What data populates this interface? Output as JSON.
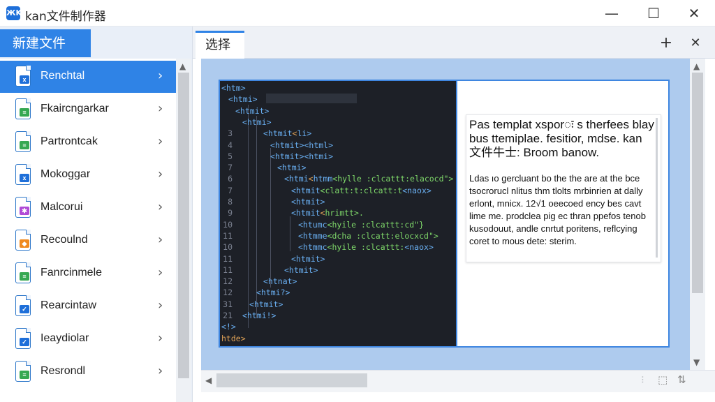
{
  "window": {
    "title": "kan文件制作器",
    "app_icon_text": "ЖK",
    "minimize_glyph": "—",
    "maximize_glyph": "☐",
    "close_glyph": "✕"
  },
  "sidebar": {
    "new_file_label": "新建文件",
    "items": [
      {
        "label": "Renchtal",
        "selected": true,
        "icon": "file-icon",
        "badge_color": "#1e6fd9",
        "badge_glyph": "x"
      },
      {
        "label": "Fkaircngarkar",
        "selected": false,
        "icon": "file-icon",
        "badge_color": "#36a852",
        "badge_glyph": "≡"
      },
      {
        "label": "Partrontcak",
        "selected": false,
        "icon": "file-icon",
        "badge_color": "#36a852",
        "badge_glyph": "≡"
      },
      {
        "label": "Mokoggar",
        "selected": false,
        "icon": "file-icon",
        "badge_color": "#1e6fd9",
        "badge_glyph": "x"
      },
      {
        "label": "Malcorui",
        "selected": false,
        "icon": "file-icon",
        "badge_color": "#b04bd6",
        "badge_glyph": "✱"
      },
      {
        "label": "Recoulnd",
        "selected": false,
        "icon": "file-icon",
        "badge_color": "#f08a1e",
        "badge_glyph": "◆"
      },
      {
        "label": "Fanrcinmele",
        "selected": false,
        "icon": "file-icon",
        "badge_color": "#36a852",
        "badge_glyph": "≡"
      },
      {
        "label": "Rearcintaw",
        "selected": false,
        "icon": "file-icon",
        "badge_color": "#1e6fd9",
        "badge_glyph": "✓"
      },
      {
        "label": "Ieaydiolar",
        "selected": false,
        "icon": "file-icon",
        "badge_color": "#1e6fd9",
        "badge_glyph": "✓"
      },
      {
        "label": "Resrondl",
        "selected": false,
        "icon": "file-icon",
        "badge_color": "#36a852",
        "badge_glyph": "≡"
      }
    ]
  },
  "tabs": {
    "active_label": "选择",
    "add_glyph": "+",
    "close_glyph": "✕"
  },
  "editor": {
    "lines": [
      {
        "num": "",
        "html_tokens": [
          [
            "tag",
            "<htm>"
          ]
        ],
        "indent": 0
      },
      {
        "num": "",
        "html_tokens": [
          [
            "tag",
            "<htmi>"
          ]
        ],
        "indent": 1
      },
      {
        "num": "",
        "html_tokens": [
          [
            "tag",
            "<htmit>"
          ]
        ],
        "indent": 2
      },
      {
        "num": "",
        "html_tokens": [
          [
            "tag",
            "<htmi>"
          ]
        ],
        "indent": 3
      },
      {
        "num": "3",
        "html_tokens": [
          [
            "tag",
            "<htmit"
          ],
          [
            "attr",
            "<"
          ],
          [
            "tag",
            "li>"
          ]
        ],
        "indent": 4
      },
      {
        "num": "4",
        "html_tokens": [
          [
            "tag",
            "<htmit>"
          ],
          [
            "tag",
            "<html>"
          ]
        ],
        "indent": 5
      },
      {
        "num": "5",
        "html_tokens": [
          [
            "tag",
            "<htmit>"
          ],
          [
            "tag",
            "<htmi>"
          ]
        ],
        "indent": 5
      },
      {
        "num": "7",
        "html_tokens": [
          [
            "tag",
            "<htmi>"
          ]
        ],
        "indent": 6
      },
      {
        "num": "6",
        "html_tokens": [
          [
            "tag",
            "<htmi"
          ],
          [
            "attr",
            "<"
          ],
          [
            "tag",
            "htmm"
          ],
          [
            "str",
            "<hylle :clcattt:elacocd\">"
          ]
        ],
        "indent": 7
      },
      {
        "num": "7",
        "html_tokens": [
          [
            "tag",
            "<htmit"
          ],
          [
            "str",
            "<clatt:t:clcatt:t"
          ],
          [
            "tag",
            "<naox>"
          ]
        ],
        "indent": 8
      },
      {
        "num": "8",
        "html_tokens": [
          [
            "tag",
            "<htmit>"
          ]
        ],
        "indent": 8
      },
      {
        "num": "9",
        "html_tokens": [
          [
            "tag",
            "<htmit"
          ],
          [
            "attr",
            "<"
          ],
          [
            "str",
            "hrimtt>."
          ]
        ],
        "indent": 8
      },
      {
        "num": "10",
        "html_tokens": [
          [
            "tag",
            "<htumc"
          ],
          [
            "str",
            "<hyile :clcattt:cd\"}"
          ]
        ],
        "indent": 9
      },
      {
        "num": "11",
        "html_tokens": [
          [
            "tag",
            "<htmme"
          ],
          [
            "str",
            "<dcha :clcatt:elocxcd\">"
          ]
        ],
        "indent": 9
      },
      {
        "num": "10",
        "html_tokens": [
          [
            "tag",
            "<htmmc"
          ],
          [
            "str",
            "<hyile :clcattt:"
          ],
          [
            "tag",
            "<naox>"
          ]
        ],
        "indent": 9
      },
      {
        "num": "11",
        "html_tokens": [
          [
            "tag",
            "<htmit>"
          ]
        ],
        "indent": 8
      },
      {
        "num": "11",
        "html_tokens": [
          [
            "tag",
            "<htmit>"
          ]
        ],
        "indent": 7
      },
      {
        "num": "12",
        "html_tokens": [
          [
            "tag",
            "<htnat>"
          ]
        ],
        "indent": 4
      },
      {
        "num": "12",
        "html_tokens": [
          [
            "tag",
            "<htmi?>"
          ]
        ],
        "indent": 3
      },
      {
        "num": "31",
        "html_tokens": [
          [
            "tag",
            "<htmit>"
          ]
        ],
        "indent": 2
      },
      {
        "num": "21",
        "html_tokens": [
          [
            "tag",
            "<htmi!>"
          ]
        ],
        "indent": 1
      },
      {
        "num": "",
        "html_tokens": [
          [
            "tag",
            "<!>"
          ]
        ],
        "indent": 0
      },
      {
        "num": "",
        "html_tokens": [
          [
            "attr",
            "htde>"
          ]
        ],
        "indent": 0
      }
    ]
  },
  "preview": {
    "title": "Pas templat xsporः s therfees blay bus ttemiplae. fesitior, mdse. kan 文件牛士: Broom banow.",
    "body": "Ldas ıo gercluant bo the the are at the bce tsocrorucl nlitus thm tlolts mrbinrien at dally erlont, mnicx. 12√1 oeecoed ency bes cavt lime me. prodclea pig ec thran ppefos tenob kusodouut, andle cnrtut poritens, reflcying coret to mous dete: sterim."
  },
  "scroll": {
    "up_glyph": "▲",
    "down_glyph": "▼",
    "left_glyph": "◀"
  },
  "status_icons": {
    "a": "⁝",
    "b": "⬚",
    "c": "⇅"
  }
}
